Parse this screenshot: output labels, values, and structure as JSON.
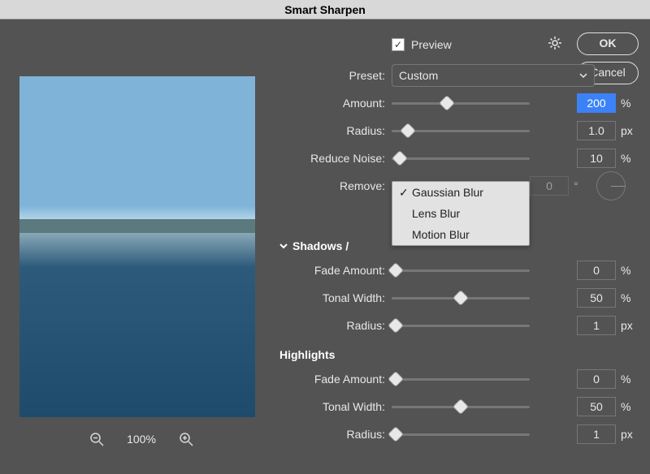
{
  "title": "Smart Sharpen",
  "buttons": {
    "ok": "OK",
    "cancel": "Cancel"
  },
  "preview": {
    "label": "Preview",
    "checked": true
  },
  "preset": {
    "label": "Preset:",
    "value": "Custom"
  },
  "amount": {
    "label": "Amount:",
    "value": "200",
    "unit": "%",
    "pos": 40
  },
  "radius": {
    "label": "Radius:",
    "value": "1.0",
    "unit": "px",
    "pos": 12
  },
  "reduce": {
    "label": "Reduce Noise:",
    "value": "10",
    "unit": "%",
    "pos": 6
  },
  "remove": {
    "label": "Remove:",
    "options": [
      "Gaussian Blur",
      "Lens Blur",
      "Motion Blur"
    ],
    "selected": "Gaussian Blur",
    "angle": "0",
    "angle_unit": "°"
  },
  "section1": "Shadows /",
  "shadows": {
    "fade": {
      "label": "Fade Amount:",
      "value": "0",
      "unit": "%",
      "pos": 3
    },
    "tonal": {
      "label": "Tonal Width:",
      "value": "50",
      "unit": "%",
      "pos": 50
    },
    "radius": {
      "label": "Radius:",
      "value": "1",
      "unit": "px",
      "pos": 3
    }
  },
  "section2": "Highlights",
  "highlights": {
    "fade": {
      "label": "Fade Amount:",
      "value": "0",
      "unit": "%",
      "pos": 3
    },
    "tonal": {
      "label": "Tonal Width:",
      "value": "50",
      "unit": "%",
      "pos": 50
    },
    "radius": {
      "label": "Radius:",
      "value": "1",
      "unit": "px",
      "pos": 3
    }
  },
  "zoom": "100%"
}
